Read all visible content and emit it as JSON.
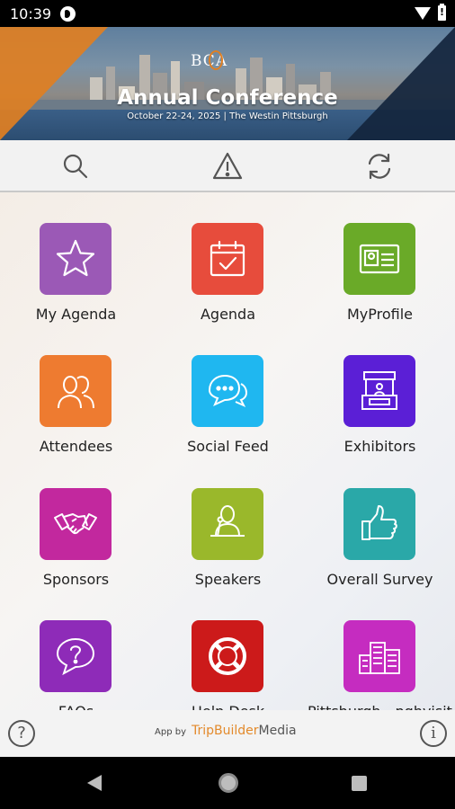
{
  "status_bar": {
    "time": "10:39"
  },
  "banner": {
    "logo": "BCA",
    "title": "Annual Conference",
    "subtitle": "October 22-24, 2025 | The Westin Pittsburgh"
  },
  "toolbar": {
    "icons": [
      "search-icon",
      "alert-triangle-icon",
      "refresh-icon"
    ]
  },
  "tiles": [
    {
      "label": "My Agenda",
      "color": "#9b59b6",
      "icon": "star-icon"
    },
    {
      "label": "Agenda",
      "color": "#e74c3c",
      "icon": "calendar-check-icon"
    },
    {
      "label": "MyProfile",
      "color": "#6aaa28",
      "icon": "id-card-icon"
    },
    {
      "label": "Attendees",
      "color": "#ee7b30",
      "icon": "people-icon"
    },
    {
      "label": "Social Feed",
      "color": "#1fb7f0",
      "icon": "chat-bubbles-icon"
    },
    {
      "label": "Exhibitors",
      "color": "#5b1fd6",
      "icon": "booth-icon"
    },
    {
      "label": "Sponsors",
      "color": "#c2289e",
      "icon": "handshake-icon"
    },
    {
      "label": "Speakers",
      "color": "#9ab82b",
      "icon": "speaker-icon"
    },
    {
      "label": "Overall Survey",
      "color": "#2aa8a8",
      "icon": "thumbs-up-icon"
    },
    {
      "label": "FAQs",
      "color": "#8e2bb8",
      "icon": "question-bubble-icon"
    },
    {
      "label": "Help Desk",
      "color": "#cc1a1a",
      "icon": "lifebuoy-icon"
    },
    {
      "label": "Pittsburgh - pghvisit",
      "color": "#c52cc0",
      "icon": "city-buildings-icon"
    }
  ],
  "footer": {
    "help_glyph": "?",
    "app_by": "App by",
    "brand_part1": "TripBuilder",
    "brand_part2": "Media",
    "info_glyph": "i"
  }
}
